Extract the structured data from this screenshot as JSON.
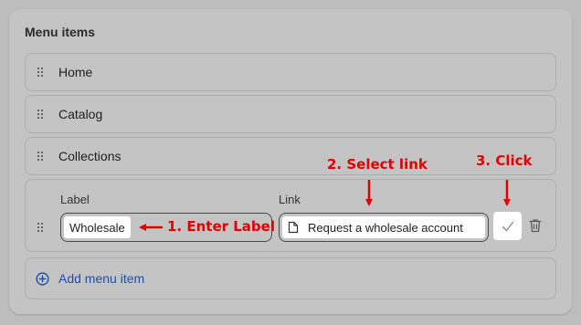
{
  "section": {
    "title": "Menu items"
  },
  "menu_items": [
    {
      "label": "Home"
    },
    {
      "label": "Catalog"
    },
    {
      "label": "Collections"
    }
  ],
  "editor": {
    "label_heading": "Label",
    "label_value": "Wholesale",
    "link_heading": "Link",
    "link_value": "Request a wholesale account",
    "confirm_icon": "check-icon",
    "delete_icon": "trash-icon"
  },
  "add_item": {
    "label": "Add menu item",
    "icon": "plus-circle-icon"
  },
  "annotations": {
    "step1": "1. Enter Label",
    "step2": "2. Select link",
    "step3": "3. Click",
    "color": "#e00000"
  },
  "colors": {
    "link": "#1f4fa8",
    "background": "#bdbdbd"
  }
}
